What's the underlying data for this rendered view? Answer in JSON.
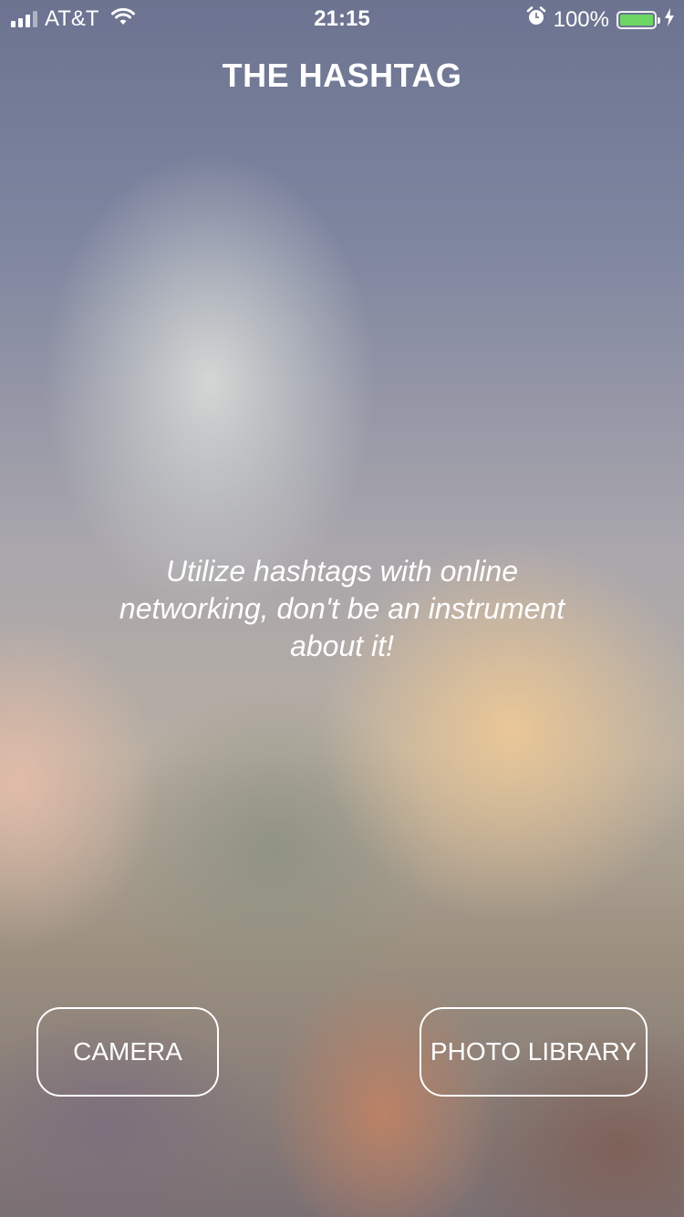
{
  "status_bar": {
    "carrier": "AT&T",
    "time": "21:15",
    "battery_percent": "100%",
    "battery_level": 1.0,
    "battery_color": "#6cd764",
    "icons": [
      "signal-icon",
      "wifi-icon",
      "alarm-icon",
      "battery-icon",
      "charging-bolt-icon"
    ]
  },
  "header": {
    "title": "THE HASHTAG"
  },
  "main": {
    "tagline": "Utilize hashtags with online networking, don't be an instrument about it!"
  },
  "actions": {
    "camera_label": "CAMERA",
    "library_label": "PHOTO LIBRARY"
  }
}
